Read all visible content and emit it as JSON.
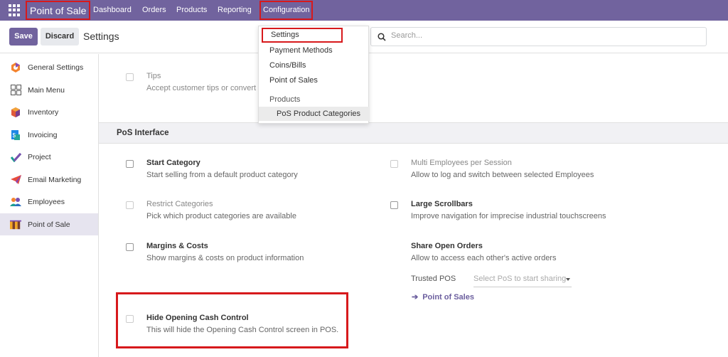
{
  "topnav": {
    "brand": "Point of Sale",
    "menu": [
      "Dashboard",
      "Orders",
      "Products",
      "Reporting",
      "Configuration"
    ]
  },
  "control_panel": {
    "save_label": "Save",
    "discard_label": "Discard",
    "title": "Settings",
    "search_placeholder": "Search..."
  },
  "sidebar": {
    "items": [
      {
        "label": "General Settings",
        "icon": "general-settings-icon"
      },
      {
        "label": "Main Menu",
        "icon": "main-menu-icon"
      },
      {
        "label": "Inventory",
        "icon": "inventory-icon"
      },
      {
        "label": "Invoicing",
        "icon": "invoicing-icon"
      },
      {
        "label": "Project",
        "icon": "project-icon"
      },
      {
        "label": "Email Marketing",
        "icon": "email-marketing-icon"
      },
      {
        "label": "Employees",
        "icon": "employees-icon"
      },
      {
        "label": "Point of Sale",
        "icon": "point-of-sale-icon",
        "active": true
      }
    ]
  },
  "dropdown": {
    "items": [
      "Settings",
      "Payment Methods",
      "Coins/Bills",
      "Point of Sales"
    ],
    "group_header": "Products",
    "sub_item": "PoS Product Categories"
  },
  "settings": {
    "tips": {
      "title": "Tips",
      "desc": "Accept customer tips or convert"
    },
    "section_title": "PoS Interface",
    "start_category": {
      "title": "Start Category",
      "desc": "Start selling from a default product category"
    },
    "multi_employees": {
      "title": "Multi Employees per Session",
      "desc": "Allow to log and switch between selected Employees"
    },
    "restrict_categories": {
      "title": "Restrict Categories",
      "desc": "Pick which product categories are available"
    },
    "large_scrollbars": {
      "title": "Large Scrollbars",
      "desc": "Improve navigation for imprecise industrial touchscreens"
    },
    "margins_costs": {
      "title": "Margins & Costs",
      "desc": "Show margins & costs on product information"
    },
    "share_open_orders": {
      "title": "Share Open Orders",
      "desc": "Allow to access each other's active orders"
    },
    "trusted_pos_label": "Trusted POS",
    "trusted_pos_placeholder": "Select PoS to start sharing",
    "point_of_sales_link": "Point of Sales",
    "hide_opening_cash": {
      "title": "Hide Opening Cash Control",
      "desc": "This will hide the Opening Cash Control screen in POS."
    }
  },
  "colors": {
    "brand": "#71639e",
    "highlight": "#d7191c"
  }
}
